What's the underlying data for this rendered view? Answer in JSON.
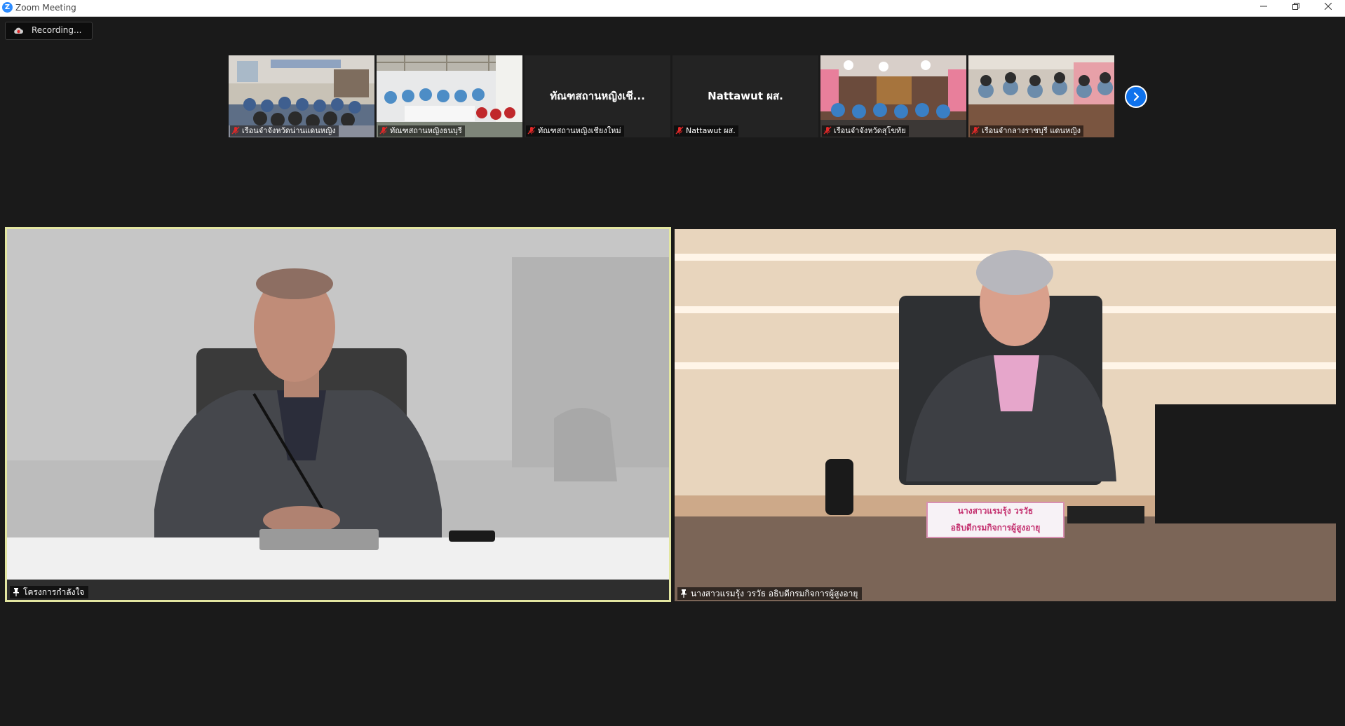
{
  "window": {
    "title": "Zoom Meeting",
    "logo_letter": "Z"
  },
  "recording": {
    "label": "Recording..."
  },
  "gallery": {
    "thumbnails": [
      {
        "name": "เรือนจำจังหวัดน่านแดนหญิง",
        "video": true,
        "muted": true
      },
      {
        "name": "ทัณฑสถานหญิงธนบุรี",
        "video": true,
        "muted": true
      },
      {
        "name": "ทัณฑสถานหญิงเชียงใหม่",
        "display_name": "ทัณฑสถานหญิงเชี...",
        "video": false,
        "muted": true
      },
      {
        "name": "Nattawut ผส.",
        "display_name": "Nattawut ผส.",
        "video": false,
        "muted": true
      },
      {
        "name": "เรือนจำจังหวัดสุโขทัย",
        "video": true,
        "muted": true
      },
      {
        "name": "เรือนจำกลางราชบุรี แดนหญิง",
        "video": true,
        "muted": true
      }
    ],
    "next_page_icon": "chevron-right-icon"
  },
  "main_videos": [
    {
      "name": "โครงการกำลังใจ",
      "pinned": true,
      "active_speaker": true
    },
    {
      "name": "นางสาวแรมรุ้ง วรวัธ อธิบดีกรมกิจการผู้สูงอายุ",
      "pinned": true,
      "active_speaker": false,
      "desk_nameplate": {
        "line1": "นางสาวแรมรุ้ง วรวัธ",
        "line2": "อธิบดีกรมกิจการผู้สูงอายุ"
      }
    }
  ],
  "colors": {
    "accent": "#0e72ed",
    "active_border": "#e3e6a1",
    "background": "#1a1a1a",
    "mute": "#e02828"
  }
}
